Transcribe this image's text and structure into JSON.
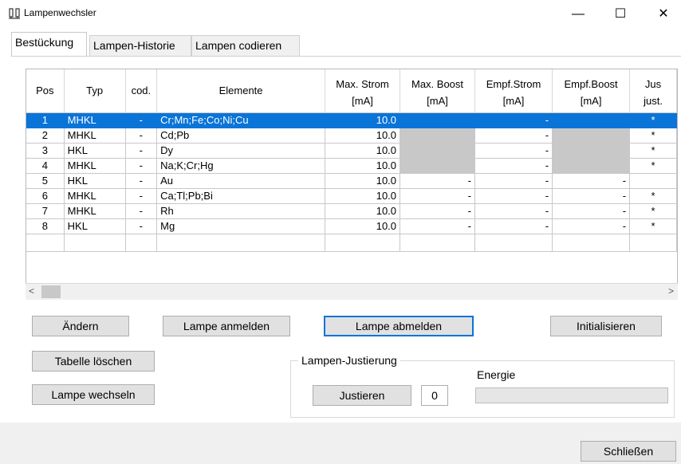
{
  "window": {
    "title": "Lampenwechsler",
    "controls": {
      "minimize": "—",
      "maximize": "☐",
      "close": "✕"
    }
  },
  "tabs": [
    {
      "label": "Bestückung",
      "active": true
    },
    {
      "label": "Lampen-Historie",
      "active": false
    },
    {
      "label": "Lampen codieren",
      "active": false
    }
  ],
  "table": {
    "header_top": [
      "Pos",
      "Typ",
      "cod.",
      "Elemente",
      "Max. Strom",
      "Max. Boost",
      "Empf.Strom",
      "Empf.Boost",
      "Jus"
    ],
    "header_units": [
      "[mA]",
      "[mA]",
      "[mA]",
      "[mA]",
      "just."
    ],
    "rows": [
      {
        "pos": "1",
        "typ": "MHKL",
        "cod": "-",
        "elemente": "Cr;Mn;Fe;Co;Ni;Cu",
        "max_strom": "10.0",
        "max_boost": "",
        "empf_strom": "-",
        "empf_boost": "",
        "just": "*",
        "selected": true
      },
      {
        "pos": "2",
        "typ": "MHKL",
        "cod": "-",
        "elemente": "Cd;Pb",
        "max_strom": "10.0",
        "max_boost": "",
        "empf_strom": "-",
        "empf_boost": "",
        "just": "*"
      },
      {
        "pos": "3",
        "typ": "HKL",
        "cod": "-",
        "elemente": "Dy",
        "max_strom": "10.0",
        "max_boost": "",
        "empf_strom": "-",
        "empf_boost": "",
        "just": "*"
      },
      {
        "pos": "4",
        "typ": "MHKL",
        "cod": "-",
        "elemente": "Na;K;Cr;Hg",
        "max_strom": "10.0",
        "max_boost": "",
        "empf_strom": "-",
        "empf_boost": "",
        "just": "*"
      },
      {
        "pos": "5",
        "typ": "HKL",
        "cod": "-",
        "elemente": "Au",
        "max_strom": "10.0",
        "max_boost": "-",
        "empf_strom": "-",
        "empf_boost": "-",
        "just": ""
      },
      {
        "pos": "6",
        "typ": "MHKL",
        "cod": "-",
        "elemente": "Ca;Tl;Pb;Bi",
        "max_strom": "10.0",
        "max_boost": "-",
        "empf_strom": "-",
        "empf_boost": "-",
        "just": "*"
      },
      {
        "pos": "7",
        "typ": "MHKL",
        "cod": "-",
        "elemente": "Rh",
        "max_strom": "10.0",
        "max_boost": "-",
        "empf_strom": "-",
        "empf_boost": "-",
        "just": "*"
      },
      {
        "pos": "8",
        "typ": "HKL",
        "cod": "-",
        "elemente": "Mg",
        "max_strom": "10.0",
        "max_boost": "-",
        "empf_strom": "-",
        "empf_boost": "-",
        "just": "*"
      }
    ],
    "scroll": {
      "left": "<",
      "right": ">"
    }
  },
  "buttons": {
    "aendern": "Ändern",
    "anmelden": "Lampe anmelden",
    "abmelden": "Lampe abmelden",
    "initialisieren": "Initialisieren",
    "tabelle_loeschen": "Tabelle löschen",
    "wechseln": "Lampe wechseln",
    "justieren": "Justieren",
    "schliessen": "Schließen"
  },
  "justierung": {
    "group_label": "Lampen-Justierung",
    "energy_label": "Energie",
    "value": "0",
    "energy_progress": 0
  },
  "colors": {
    "selection": "#0a74d8",
    "gray_cell": "#c8c8c8"
  }
}
